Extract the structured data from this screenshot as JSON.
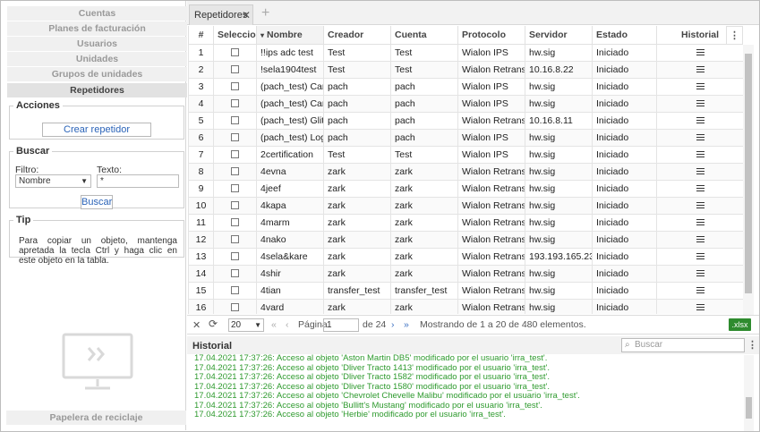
{
  "nav": {
    "items": [
      "Cuentas",
      "Planes de facturación",
      "Usuarios",
      "Unidades",
      "Grupos de unidades",
      "Repetidores"
    ],
    "active": 5
  },
  "actions": {
    "title": "Acciones",
    "create_label": "Crear repetidor"
  },
  "search": {
    "title": "Buscar",
    "filter_label": "Filtro:",
    "filter_value": "Nombre",
    "text_label": "Texto:",
    "text_value": "*",
    "button_label": "Buscar"
  },
  "tip": {
    "title": "Tip",
    "text": "Para copiar un objeto, mantenga apretada la tecla Ctrl y haga clic en este objeto en la tabla."
  },
  "recycle": {
    "label": "Papelera de reciclaje"
  },
  "tab": {
    "label": "Repetidores",
    "close": "✕",
    "add": "+"
  },
  "table": {
    "headers": [
      "#",
      "Seleccione",
      "Nombre",
      "Creador",
      "Cuenta",
      "Protocolo",
      "Servidor",
      "Estado",
      "Historial"
    ],
    "sort_indicator": "▾",
    "rows": [
      [
        "1",
        "!!ips adc test",
        "Test",
        "Test",
        "Wialon IPS",
        "hw.sig",
        "Iniciado"
      ],
      [
        "2",
        "!sela1904test",
        "Test",
        "Test",
        "Wialon Retranslator",
        "10.16.8.22",
        "Iniciado"
      ],
      [
        "3",
        "(pach_test) Caravel",
        "pach",
        "pach",
        "Wialon IPS",
        "hw.sig",
        "Iniciado"
      ],
      [
        "4",
        "(pach_test) Caravel",
        "pach",
        "pach",
        "Wialon IPS",
        "hw.sig",
        "Iniciado"
      ],
      [
        "5",
        "(pach_test) Glitch n",
        "pach",
        "pach",
        "Wialon Retranslator",
        "10.16.8.11",
        "Iniciado"
      ],
      [
        "6",
        "(pach_test) Logistic",
        "pach",
        "pach",
        "Wialon IPS",
        "hw.sig",
        "Iniciado"
      ],
      [
        "7",
        "2certification",
        "Test",
        "Test",
        "Wialon IPS",
        "hw.sig",
        "Iniciado"
      ],
      [
        "8",
        "4evna",
        "zark",
        "zark",
        "Wialon Retranslator",
        "hw.sig",
        "Iniciado"
      ],
      [
        "9",
        "4jeef",
        "zark",
        "zark",
        "Wialon Retranslator",
        "hw.sig",
        "Iniciado"
      ],
      [
        "10",
        "4kapa",
        "zark",
        "zark",
        "Wialon Retranslator",
        "hw.sig",
        "Iniciado"
      ],
      [
        "11",
        "4marm",
        "zark",
        "zark",
        "Wialon Retranslator",
        "hw.sig",
        "Iniciado"
      ],
      [
        "12",
        "4nako",
        "zark",
        "zark",
        "Wialon Retranslator",
        "hw.sig",
        "Iniciado"
      ],
      [
        "13",
        "4sela&kare",
        "zark",
        "zark",
        "Wialon Retranslator",
        "193.193.165.235",
        "Iniciado"
      ],
      [
        "14",
        "4shir",
        "zark",
        "zark",
        "Wialon Retranslator",
        "hw.sig",
        "Iniciado"
      ],
      [
        "15",
        "4tian",
        "transfer_test",
        "transfer_test",
        "Wialon Retranslator",
        "hw.sig",
        "Iniciado"
      ],
      [
        "16",
        "4vard",
        "zark",
        "zark",
        "Wialon Retranslator",
        "hw.sig",
        "Iniciado"
      ]
    ]
  },
  "pager": {
    "page_size": "20",
    "page_label": "Página",
    "page_value": "1",
    "of_label": "de 24",
    "summary": "Mostrando de 1 a 20 de 480 elementos.",
    "export_label": ".xlsx"
  },
  "history": {
    "title": "Historial",
    "search_placeholder": "Buscar",
    "lines": [
      "17.04.2021  17:37:26: Acceso al objeto 'Aston Martin DB5' modificado por el usuario 'irra_test'.",
      "17.04.2021  17:37:26: Acceso al objeto 'Dliver Tracto 1413' modificado por el usuario 'irra_test'.",
      "17.04.2021  17:37:26: Acceso al objeto 'Dliver Tracto 1582' modificado por el usuario 'irra_test'.",
      "17.04.2021  17:37:26: Acceso al objeto 'Dliver Tracto 1580' modificado por el usuario 'irra_test'.",
      "17.04.2021  17:37:26: Acceso al objeto 'Chevrolet Chevelle Malibu' modificado por el usuario 'irra_test'.",
      "17.04.2021  17:37:26: Acceso al objeto 'Bullitt's Mustang' modificado por el usuario 'irra_test'.",
      "17.04.2021  17:37:26: Acceso al objeto 'Herbie' modificado por el usuario 'irra_test'."
    ]
  },
  "colors": {
    "accent": "#2a63b8",
    "log_green": "#2e9a2e",
    "export_green": "#2e8b2e"
  }
}
